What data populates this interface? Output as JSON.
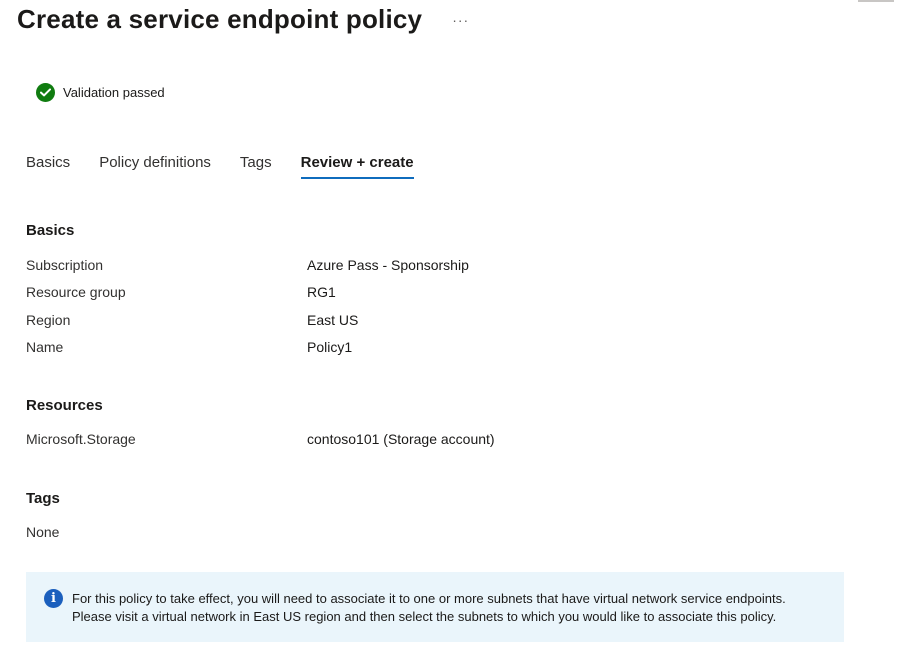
{
  "header": {
    "title": "Create a service endpoint policy",
    "more_label": "···"
  },
  "validation": {
    "text": "Validation passed",
    "icon": "check-circle-icon",
    "color": "#107c10"
  },
  "tabs": [
    {
      "label": "Basics",
      "active": false
    },
    {
      "label": "Policy definitions",
      "active": false
    },
    {
      "label": "Tags",
      "active": false
    },
    {
      "label": "Review + create",
      "active": true
    }
  ],
  "basics": {
    "heading": "Basics",
    "rows": [
      {
        "label": "Subscription",
        "value": "Azure Pass - Sponsorship"
      },
      {
        "label": "Resource group",
        "value": "RG1"
      },
      {
        "label": "Region",
        "value": "East US"
      },
      {
        "label": "Name",
        "value": "Policy1"
      }
    ]
  },
  "resources": {
    "heading": "Resources",
    "rows": [
      {
        "label": "Microsoft.Storage",
        "value": "contoso101 (Storage account)"
      }
    ]
  },
  "tags": {
    "heading": "Tags",
    "value": "None"
  },
  "info": {
    "icon": "info-icon",
    "line1": "For this policy to take effect, you will need to associate it to one or more subnets that have virtual network service endpoints.",
    "line2": "Please visit a virtual network in East US region and then select the subnets to which you would like to associate this policy."
  },
  "colors": {
    "accent": "#0f6cbd",
    "info_background": "#eaf5fb",
    "success": "#107c10"
  }
}
